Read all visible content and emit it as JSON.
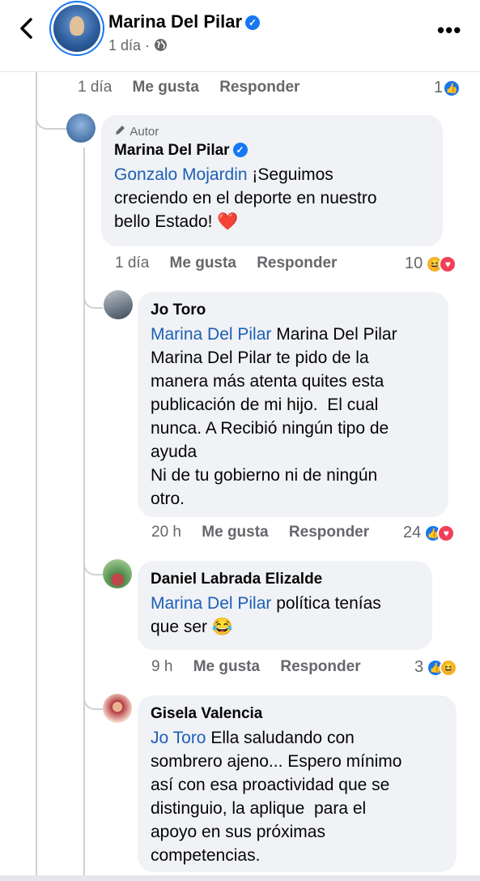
{
  "header": {
    "name": "Marina Del Pilar",
    "time": "1 día",
    "separator": "·",
    "more_label": "•••"
  },
  "top_actions": {
    "time": "1 día",
    "like": "Me gusta",
    "reply": "Responder",
    "count": "1"
  },
  "comments": [
    {
      "badge": "Autor",
      "name": "Marina Del Pilar",
      "mention": "Gonzalo Mojardin",
      "text": " ¡Seguimos\ncreciendo en el deporte en nuestro\nbello Estado! ❤️",
      "time": "1 día",
      "like": "Me gusta",
      "reply": "Responder",
      "count": "10"
    },
    {
      "name": "Jo Toro",
      "mention": "Marina Del Pilar",
      "text": " Marina Del Pilar\nMarina Del Pilar te pido de la\nmanera más atenta quites esta\npublicación de mi hijo.  El cual\nnunca. A Recibió ningún tipo de\nayuda\nNi de tu gobierno ni de ningún\notro.",
      "time": "20 h",
      "like": "Me gusta",
      "reply": "Responder",
      "count": "24"
    },
    {
      "name": "Daniel Labrada Elizalde",
      "mention": "Marina Del Pilar",
      "text": " política tenías\nque ser 😂",
      "time": "9 h",
      "like": "Me gusta",
      "reply": "Responder",
      "count": "3"
    },
    {
      "name": "Gisela Valencia",
      "mention": "Jo Toro",
      "text": " Ella saludando con\nsombrero ajeno... Espero mínimo\nasí con esa proactividad que se\ndistinguio, la aplique  para el\napoyo en sus próximas\ncompetencias."
    }
  ],
  "colors": {
    "link": "#1d5fb8",
    "bubble": "#f0f2f5",
    "like": "#1877f2",
    "love": "#f33e58",
    "haha": "#f7b125"
  }
}
